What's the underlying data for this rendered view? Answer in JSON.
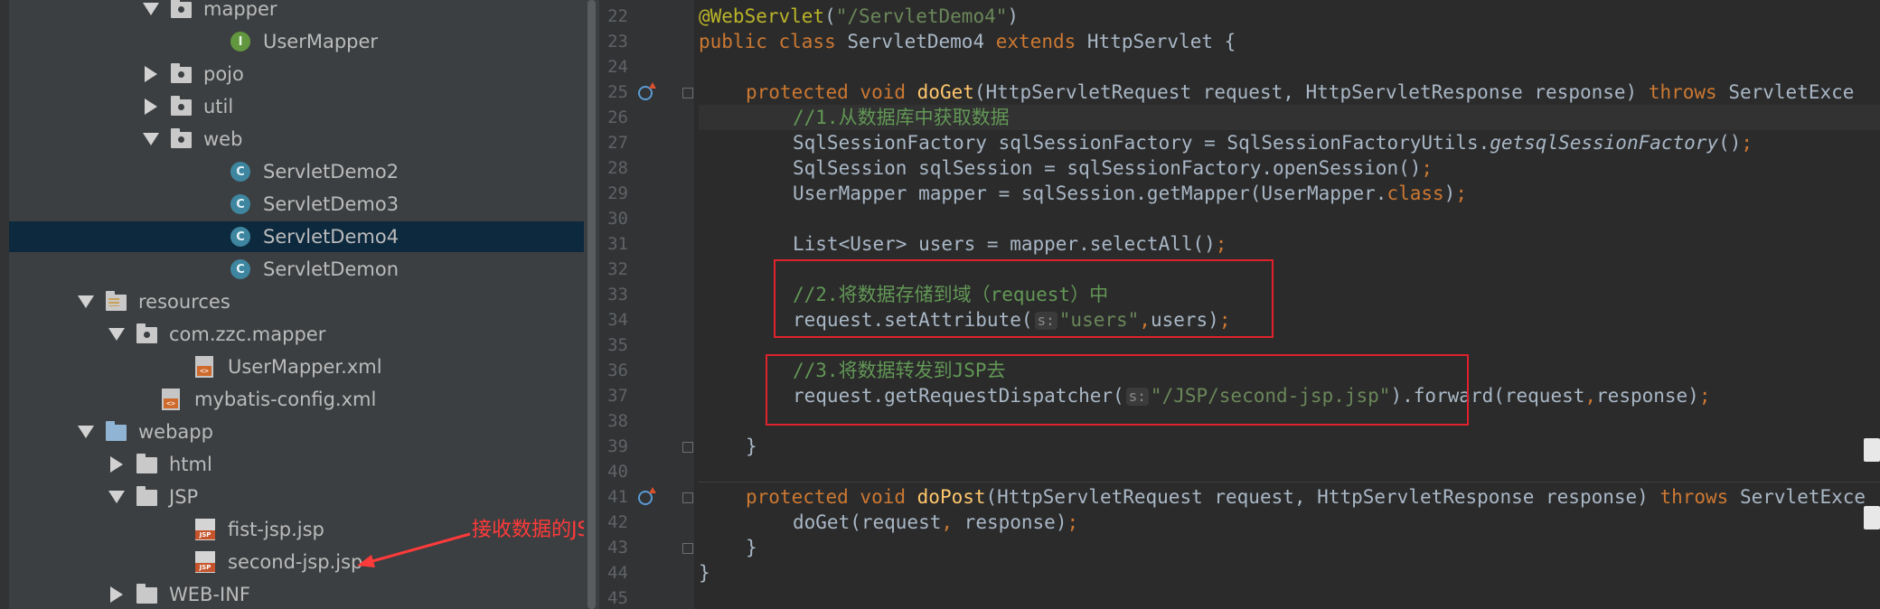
{
  "project_tree": {
    "items": [
      {
        "label": "mapper",
        "icon": "package-folder-icon",
        "expand": "down",
        "level": "pkg"
      },
      {
        "label": "UserMapper",
        "icon": "interface-icon",
        "expand": "none",
        "level": "file"
      },
      {
        "label": "pojo",
        "icon": "package-folder-icon",
        "expand": "right",
        "level": "pkg"
      },
      {
        "label": "util",
        "icon": "package-folder-icon",
        "expand": "right",
        "level": "pkg"
      },
      {
        "label": "web",
        "icon": "package-folder-icon",
        "expand": "down",
        "level": "pkg"
      },
      {
        "label": "ServletDemo2",
        "icon": "class-icon",
        "expand": "none",
        "level": "file"
      },
      {
        "label": "ServletDemo3",
        "icon": "class-icon",
        "expand": "none",
        "level": "file"
      },
      {
        "label": "ServletDemo4",
        "icon": "class-icon",
        "expand": "none",
        "level": "file",
        "selected": true
      },
      {
        "label": "ServletDemon",
        "icon": "class-icon",
        "expand": "none",
        "level": "file"
      },
      {
        "label": "resources",
        "icon": "resources-folder-icon",
        "expand": "down",
        "level": "top"
      },
      {
        "label": "com.zzc.mapper",
        "icon": "package-folder-icon",
        "expand": "down",
        "level": "sub"
      },
      {
        "label": "UserMapper.xml",
        "icon": "xml-file-icon",
        "expand": "none",
        "level": "subfile"
      },
      {
        "label": "mybatis-config.xml",
        "icon": "xml-file-icon",
        "expand": "none",
        "level": "sub2"
      },
      {
        "label": "webapp",
        "icon": "web-folder-icon",
        "expand": "down",
        "level": "top"
      },
      {
        "label": "html",
        "icon": "folder-icon",
        "expand": "right",
        "level": "sub"
      },
      {
        "label": "JSP",
        "icon": "folder-icon",
        "expand": "down",
        "level": "sub"
      },
      {
        "label": "fist-jsp.jsp",
        "icon": "jsp-file-icon",
        "expand": "none",
        "level": "subfile"
      },
      {
        "label": "second-jsp.jsp",
        "icon": "jsp-file-icon",
        "expand": "none",
        "level": "subfile"
      },
      {
        "label": "WEB-INF",
        "icon": "folder-icon",
        "expand": "right",
        "level": "sub"
      }
    ],
    "annotation": "接收数据的JSP"
  },
  "editor": {
    "line_numbers": [
      "22",
      "23",
      "24",
      "25",
      "26",
      "27",
      "28",
      "29",
      "30",
      "31",
      "32",
      "33",
      "34",
      "35",
      "36",
      "37",
      "38",
      "39",
      "40",
      "41",
      "42",
      "43",
      "44",
      "45"
    ],
    "hint_label": "s:",
    "code": {
      "l22_ann": "@WebServlet",
      "l22_open": "(",
      "l22_str": "\"/ServletDemo4\"",
      "l22_close": ")",
      "l23_kw": "public class ",
      "l23_name": "ServletDemo4 ",
      "l23_ext": "extends ",
      "l23_rest": "HttpServlet {",
      "l25_kw": "protected void ",
      "l25_fn": "doGet",
      "l25_rest": "(HttpServletRequest request, HttpServletResponse response) ",
      "l25_throws": "throws ",
      "l25_exc": "ServletExce",
      "l26": "//1.从数据库中获取数据",
      "l27_a": "SqlSessionFactory sqlSessionFactory = SqlSessionFactoryUtils.",
      "l27_it": "getsqlSessionFactory",
      "l27_b": "()",
      "l27_semi": ";",
      "l28_a": "SqlSession sqlSession = sqlSessionFactory.openSession()",
      "l28_semi": ";",
      "l29_a": "UserMapper mapper = sqlSession.getMapper(UserMapper.",
      "l29_kw": "class",
      "l29_b": ")",
      "l29_semi": ";",
      "l31_a": "List<User> users = mapper.selectAll()",
      "l31_semi": ";",
      "l33": "//2.将数据存储到域（request）中",
      "l34_a": "request.setAttribute(",
      "l34_str": "\"users\"",
      "l34_comma": ",",
      "l34_b": "users)",
      "l34_semi": ";",
      "l36": "//3.将数据转发到JSP去",
      "l37_a": "request.getRequestDispatcher(",
      "l37_str": "\"/JSP/second-jsp.jsp\"",
      "l37_b": ").forward(request",
      "l37_comma": ",",
      "l37_c": "response)",
      "l37_semi": ";",
      "l39": "}",
      "l41_kw": "protected void ",
      "l41_fn": "doPost",
      "l41_rest": "(HttpServletRequest request, HttpServletResponse response) ",
      "l41_throws": "throws ",
      "l41_exc": "ServletExce",
      "l42_a": "doGet(request",
      "l42_comma": ", ",
      "l42_b": "response)",
      "l42_semi": ";",
      "l43": "}",
      "l44": "}"
    }
  },
  "colors": {
    "keyword": "#cc7832",
    "method": "#ffc66d",
    "string": "#6a8759",
    "annotation": "#bbb529",
    "comment": "#629755",
    "highlight_box": "#e0222c",
    "selection": "#0d293e"
  }
}
